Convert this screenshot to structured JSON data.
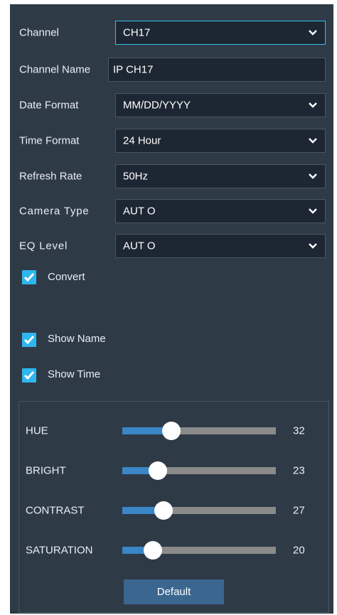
{
  "form": {
    "channel": {
      "label": "Channel",
      "value": "CH17"
    },
    "channel_name": {
      "label": "Channel Name",
      "value": "IP CH17"
    },
    "date_format": {
      "label": "Date Format",
      "value": "MM/DD/YYYY"
    },
    "time_format": {
      "label": "Time Format",
      "value": "24 Hour"
    },
    "refresh_rate": {
      "label": "Refresh Rate",
      "value": "50Hz"
    },
    "camera_type": {
      "label": "Camera Type",
      "value": "AUT O"
    },
    "eq_level": {
      "label": "EQ Level",
      "value": "AUT O"
    }
  },
  "checkboxes": [
    {
      "label": "Convert",
      "checked": true
    },
    {
      "label": "Show Name",
      "checked": true
    },
    {
      "label": "Show Time",
      "checked": true
    }
  ],
  "sliders": [
    {
      "label": "HUE",
      "value": 32,
      "max": 100
    },
    {
      "label": "BRIGHT",
      "value": 23,
      "max": 100
    },
    {
      "label": "CONTRAST",
      "value": 27,
      "max": 100
    },
    {
      "label": "SATURATION",
      "value": 20,
      "max": 100
    }
  ],
  "buttons": {
    "default_label": "Default"
  },
  "colors": {
    "panel_bg": "#2f3a47",
    "field_bg": "#1d2733",
    "accent": "#36bfe6",
    "checkbox": "#2fb6ee",
    "slider_fill": "#3a86c7",
    "slider_track": "#8a8a8a",
    "button_bg": "#3a6690"
  },
  "icons": {
    "dropdown": "chevron-down-icon",
    "checkbox": "checkmark-icon"
  }
}
